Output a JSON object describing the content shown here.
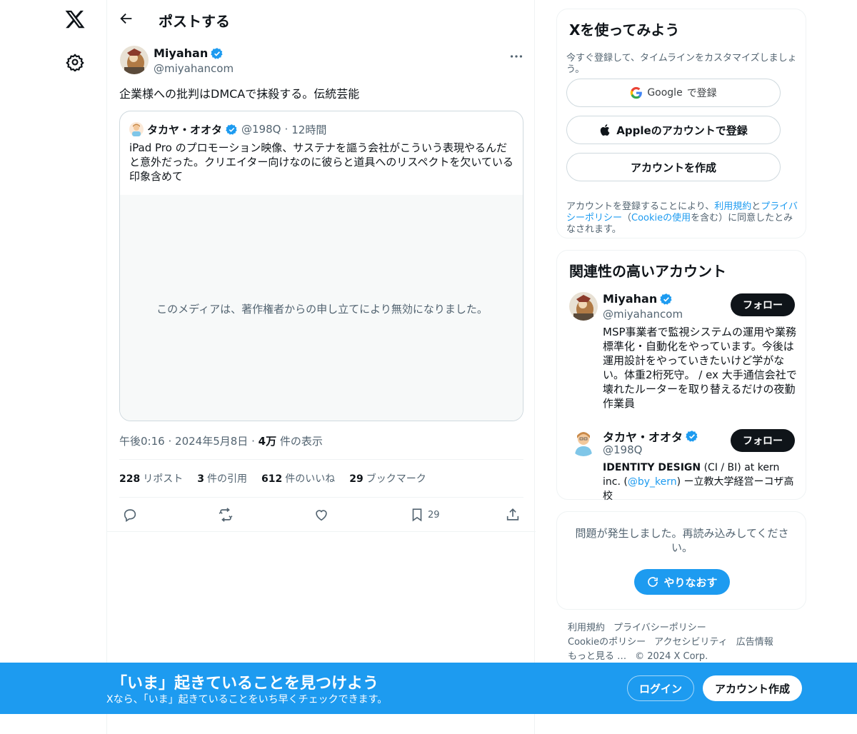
{
  "header": {
    "title": "ポストする"
  },
  "post": {
    "author_name": "Miyahan",
    "author_handle": "@miyahancom",
    "text": "企業様への批判はDMCAで抹殺する。伝統芸能",
    "quote": {
      "author_name": "タカヤ・オオタ",
      "author_handle": "@198Q",
      "separator": "·",
      "time": "12時間",
      "text": "iPad Pro のプロモーション映像、サステナを謳う会社がこういう表現やるんだと意外だった。クリエイター向けなのに彼らと道具へのリスペクトを欠いている印象含めて",
      "media_message": "このメディアは、著作権者からの申し立てにより無効になりました。"
    },
    "time": "午後0:16",
    "date": "2024年5月8日",
    "views_count": "4万",
    "views_label": "件の表示",
    "dot": "·",
    "stats": [
      {
        "num": "228",
        "label": "リポスト"
      },
      {
        "num": "3",
        "label": "件の引用"
      },
      {
        "num": "612",
        "label": "件のいいね"
      },
      {
        "num": "29",
        "label": "ブックマーク"
      }
    ],
    "bookmark_count": "29"
  },
  "signup": {
    "title": "Xを使ってみよう",
    "desc": "今すぐ登録して、タイムラインをカスタマイズしましょう。",
    "google_brand": "Google",
    "google_label": "で登録",
    "apple_label": "Appleのアカウントで登録",
    "create_label": "アカウントを作成",
    "legal_1": "アカウントを登録することにより、",
    "legal_terms": "利用規約",
    "legal_2": "と",
    "legal_privacy": "プライバシーポリシー",
    "legal_3": "（",
    "legal_cookie": "Cookieの使用",
    "legal_4": "を含む）に同意したとみなされます。"
  },
  "related": {
    "title": "関連性の高いアカウント",
    "follow_label": "フォロー",
    "accounts": [
      {
        "name": "Miyahan",
        "handle": "@miyahancom",
        "bio": "MSP事業者で監視システムの運用や業務標準化・自動化をやっています。今後は運用設計をやっていきたいけど学がない。体重2桁死守。 / ex 大手通信会社で壊れたルーターを取り替えるだけの夜勤作業員"
      },
      {
        "name": "タカヤ・オオタ",
        "handle": "@198Q",
        "bio_bold": "IDENTITY DESIGN",
        "bio_1": " (CI / BI) at kern inc. (",
        "bio_link": "@by_kern",
        "bio_2": ") ー立教大学経営ーコザ高校"
      }
    ]
  },
  "error": {
    "message": "問題が発生しました。再読み込みしてください。",
    "retry_label": "やりなおす"
  },
  "footer": {
    "links": [
      "利用規約",
      "プライバシーポリシー",
      "Cookieのポリシー",
      "アクセシビリティ",
      "広告情報",
      "もっと見る …"
    ],
    "copyright": "© 2024 X Corp."
  },
  "banner": {
    "title": "「いま」起きていることを見つけよう",
    "subtitle": "Xなら、「いま」起きていることをいち早くチェックできます。",
    "login_label": "ログイン",
    "create_label": "アカウント作成"
  },
  "colors": {
    "accent": "#1d9bf0",
    "text": "#0f1419",
    "muted": "#536471",
    "border": "#eff3f4"
  }
}
